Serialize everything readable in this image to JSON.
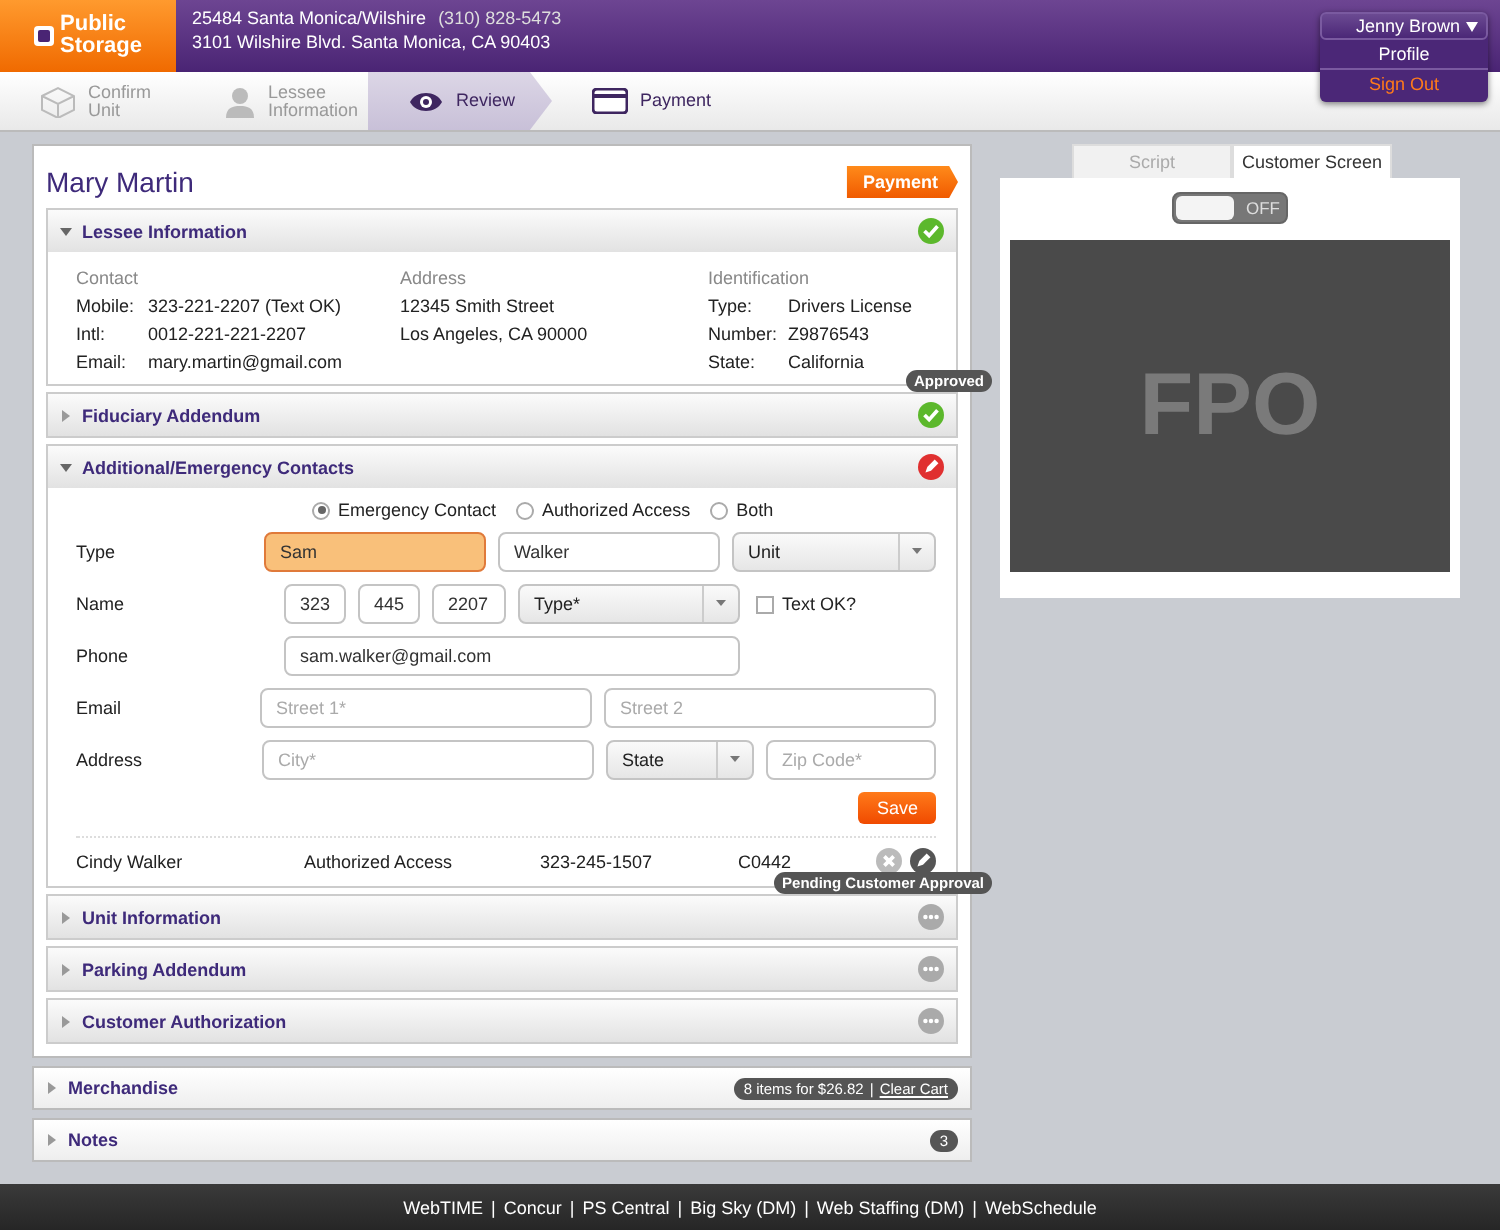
{
  "header": {
    "logo": [
      "Public",
      "Storage"
    ],
    "store": "25484 Santa Monica/Wilshire",
    "phone": "(310) 828-5473",
    "address": "3101 Wilshire Blvd. Santa Monica, CA 90403"
  },
  "user_menu": {
    "name": "Jenny Brown",
    "expanded": true,
    "items": [
      {
        "label": "Profile",
        "kind": "link"
      },
      {
        "label": "Sign Out",
        "kind": "signout"
      }
    ]
  },
  "steps": [
    {
      "label": "Confirm Unit",
      "kind": "box",
      "selected": false,
      "disabled": true
    },
    {
      "label": "Lessee Information",
      "kind": "person",
      "selected": false,
      "disabled": true
    },
    {
      "label": "Review",
      "kind": "eye",
      "selected": true,
      "disabled": false
    },
    {
      "label": "Payment",
      "kind": "card",
      "selected": false,
      "disabled": false
    }
  ],
  "customer": {
    "name": "Mary Martin",
    "badge": "Payment"
  },
  "sections": [
    {
      "kind": "lessee",
      "title": "Lessee Information",
      "expanded": true,
      "status": {
        "kind": "approved"
      }
    },
    {
      "title": "Fiduciary Addendum",
      "expanded": false,
      "status": {
        "kind": "approved"
      },
      "tooltip": "Approved"
    },
    {
      "kind": "contacts",
      "title": "Additional/Emergency Contacts",
      "expanded": true,
      "status": {
        "kind": "edit"
      }
    },
    {
      "title": "Unit Information",
      "expanded": false,
      "status": {
        "kind": "pending"
      },
      "tooltip": "Pending Customer Approval"
    },
    {
      "title": "Parking Addendum",
      "expanded": false,
      "status": {
        "kind": "pending"
      }
    },
    {
      "title": "Customer Authorization",
      "expanded": false,
      "status": {
        "kind": "pending"
      }
    }
  ],
  "lessee": [
    {
      "heading": "Contact",
      "rows": [
        {
          "label": "Mobile:",
          "value": "323-221-2207 (Text OK)"
        },
        {
          "label": "Intl:",
          "value": "0012-221-221-2207"
        },
        {
          "label": "Email:",
          "value": "mary.martin@gmail.com"
        }
      ]
    },
    {
      "heading": "Address",
      "rows": [
        {
          "value": "12345 Smith Street"
        },
        {
          "value": "Los Angeles, CA 90000"
        }
      ]
    },
    {
      "heading": "Identification",
      "rows": [
        {
          "label": "Type:",
          "value": "Drivers License"
        },
        {
          "label": "Number:",
          "value": "Z9876543"
        },
        {
          "label": "State:",
          "value": "California"
        }
      ]
    }
  ],
  "contacts": {
    "radios": [
      {
        "label": "Emergency Contact",
        "selected": true
      },
      {
        "label": "Authorized Access",
        "selected": false
      },
      {
        "label": "Both",
        "selected": false
      }
    ],
    "rows": [
      {
        "label": "Type",
        "fields": [
          {
            "kind": "input",
            "value": "Sam",
            "focused": true
          },
          {
            "kind": "input",
            "value": "Walker",
            "focused": false
          },
          {
            "kind": "select",
            "value": "Unit"
          }
        ]
      },
      {
        "label": "Name",
        "fields": [
          {
            "kind": "input",
            "value": "323",
            "focused": false
          },
          {
            "kind": "input",
            "value": "445",
            "focused": false
          },
          {
            "kind": "input",
            "value": "2207",
            "focused": false
          },
          {
            "kind": "select",
            "value": "Type*"
          },
          {
            "kind": "checkbox",
            "label": "Text OK?",
            "checked": false
          }
        ]
      },
      {
        "label": "Phone",
        "fields": [
          {
            "kind": "input",
            "value": "sam.walker@gmail.com",
            "focused": false
          }
        ]
      },
      {
        "label": "Email",
        "fields": [
          {
            "kind": "input",
            "placeholder": "Street 1*",
            "focused": false
          },
          {
            "kind": "input",
            "placeholder": "Street 2",
            "focused": false
          }
        ]
      },
      {
        "label": "Address",
        "fields": [
          {
            "kind": "input",
            "placeholder": "City*",
            "focused": false
          },
          {
            "kind": "select",
            "value": "State"
          },
          {
            "kind": "input",
            "placeholder": "Zip Code*",
            "focused": false
          }
        ]
      }
    ],
    "save": "Save",
    "list": [
      {
        "cells": [
          "Cindy Walker",
          "Authorized Access",
          "323-245-1507",
          "C0442"
        ]
      }
    ]
  },
  "merchandise": {
    "title": "Merchandise",
    "expanded": false,
    "summary": "8 items for $26.82",
    "separator": "|",
    "link": "Clear Cart"
  },
  "notes": {
    "title": "Notes",
    "expanded": false,
    "count": "3"
  },
  "side": {
    "tabs": [
      {
        "label": "Script",
        "selected": false
      },
      {
        "label": "Customer Screen",
        "selected": true
      }
    ],
    "toggle": {
      "on": false,
      "label": "OFF"
    },
    "preview": "FPO"
  },
  "footer": {
    "separator": "|",
    "links": [
      "WebTIME",
      "Concur",
      "PS Central",
      "Big Sky (DM)",
      "Web Staffing (DM)",
      "WebSchedule"
    ]
  }
}
